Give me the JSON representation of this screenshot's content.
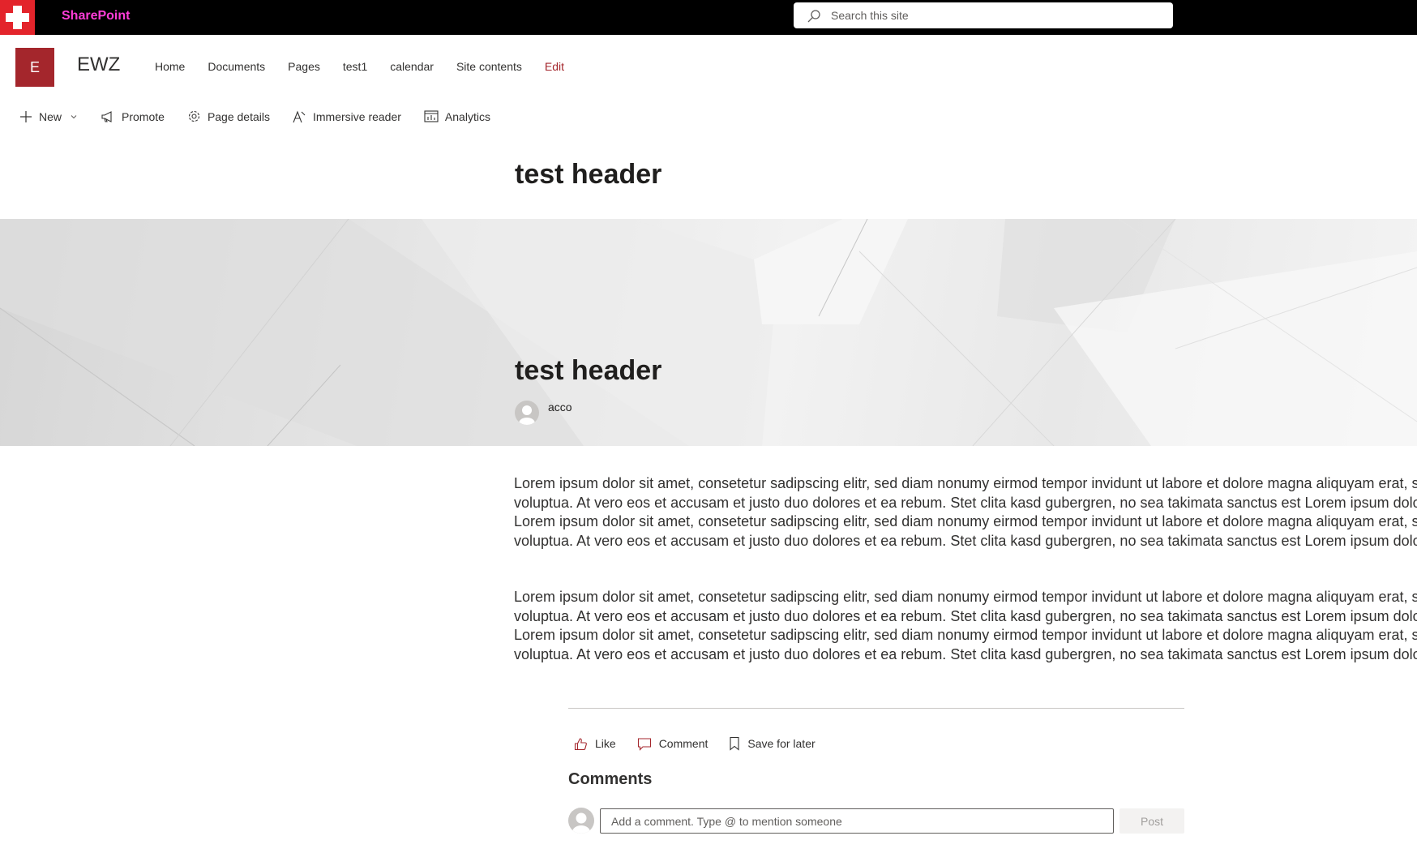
{
  "suite_bar": {
    "app_name": "SharePoint",
    "search_placeholder": "Search this site",
    "brand_color": "#e3242b",
    "app_name_color": "#ff3dd8"
  },
  "site": {
    "logo_letter": "E",
    "logo_color": "#a4262c",
    "title": "EWZ",
    "nav": [
      "Home",
      "Documents",
      "Pages",
      "test1",
      "calendar",
      "Site contents",
      "Edit"
    ]
  },
  "command_bar": {
    "new": "New",
    "promote": "Promote",
    "page_details": "Page details",
    "immersive_reader": "Immersive reader",
    "analytics": "Analytics"
  },
  "page": {
    "top_title": "test header",
    "banner_title": "test header",
    "author": "acco",
    "paragraphs": [
      [
        "Lorem ipsum dolor sit amet, consetetur sadipscing elitr, sed diam nonumy eirmod tempor invidunt ut labore et dolore magna aliquyam erat, sed diam",
        "voluptua. At vero eos et accusam et justo duo dolores et ea rebum. Stet clita kasd gubergren, no sea takimata sanctus est Lorem ipsum dolor sit amet.",
        "Lorem ipsum dolor sit amet, consetetur sadipscing elitr, sed diam nonumy eirmod tempor invidunt ut labore et dolore magna aliquyam erat, sed diam",
        "voluptua. At vero eos et accusam et justo duo dolores et ea rebum. Stet clita kasd gubergren, no sea takimata sanctus est Lorem ipsum dolor sit amet."
      ],
      [
        "Lorem ipsum dolor sit amet, consetetur sadipscing elitr, sed diam nonumy eirmod tempor invidunt ut labore et dolore magna aliquyam erat, sed diam",
        "voluptua. At vero eos et accusam et justo duo dolores et ea rebum. Stet clita kasd gubergren, no sea takimata sanctus est Lorem ipsum dolor sit amet.",
        "Lorem ipsum dolor sit amet, consetetur sadipscing elitr, sed diam nonumy eirmod tempor invidunt ut labore et dolore magna aliquyam erat, sed diam",
        "voluptua. At vero eos et accusam et justo duo dolores et ea rebum. Stet clita kasd gubergren, no sea takimata sanctus est Lorem ipsum dolor sit amet."
      ]
    ]
  },
  "social": {
    "like": "Like",
    "comment": "Comment",
    "save_for_later": "Save for later",
    "accent_color": "#a4262c"
  },
  "comments": {
    "heading": "Comments",
    "placeholder": "Add a comment. Type @ to mention someone",
    "post_label": "Post"
  }
}
